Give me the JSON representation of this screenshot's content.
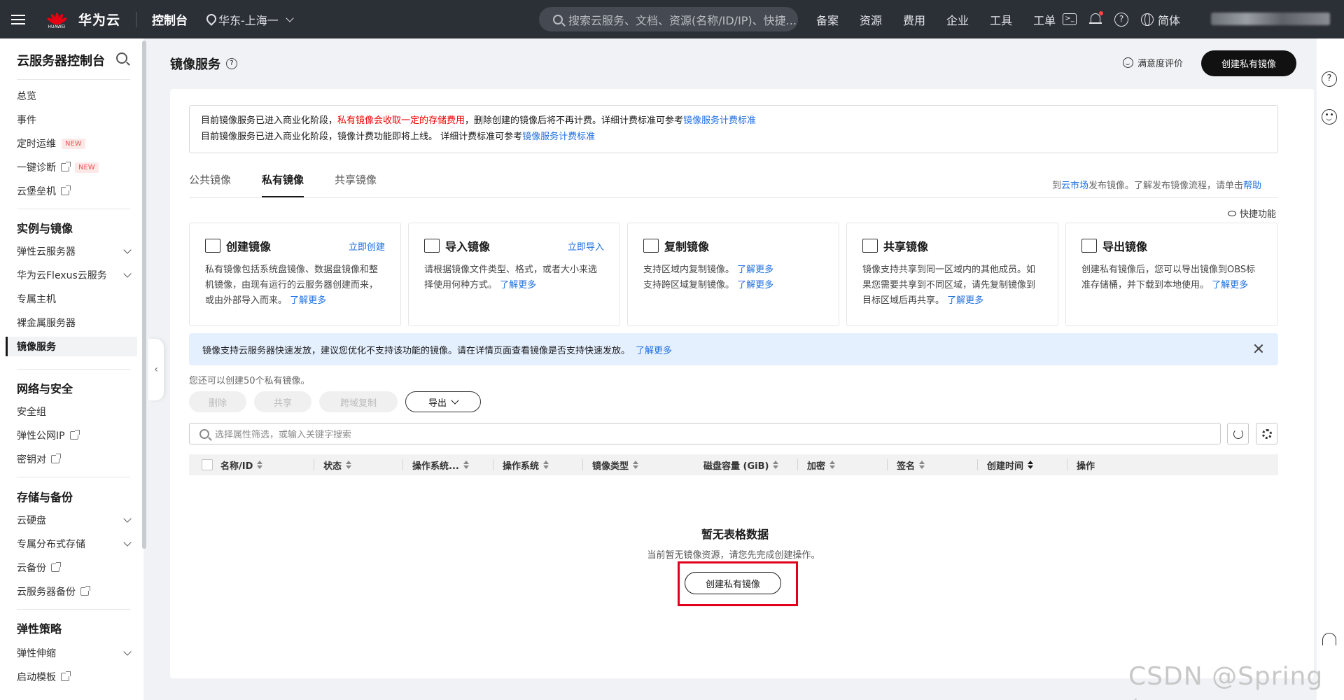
{
  "topbar": {
    "brand_small": "HUAWEI",
    "brand_name": "华为云",
    "console_label": "控制台",
    "region": "华东-上海一",
    "search_placeholder": "搜索云服务、文档、资源(名称/ID/IP)、快捷...",
    "nav": [
      "备案",
      "资源",
      "费用",
      "企业",
      "工具",
      "工单"
    ],
    "help_glyph": "?",
    "terminal_glyph": ">_",
    "language": "简体"
  },
  "sidebar": {
    "title": "云服务器控制台",
    "items_top": [
      {
        "label": "总览"
      },
      {
        "label": "事件"
      },
      {
        "label": "定时运维",
        "badge": "NEW"
      },
      {
        "label": "一键诊断",
        "badge": "NEW",
        "external": true
      },
      {
        "label": "云堡垒机",
        "external": true
      }
    ],
    "groups": [
      {
        "title": "实例与镜像",
        "items": [
          {
            "label": "弹性云服务器",
            "expandable": true
          },
          {
            "label": "华为云Flexus云服务",
            "expandable": true
          },
          {
            "label": "专属主机"
          },
          {
            "label": "裸金属服务器"
          },
          {
            "label": "镜像服务",
            "active": true
          }
        ]
      },
      {
        "title": "网络与安全",
        "items": [
          {
            "label": "安全组"
          },
          {
            "label": "弹性公网IP",
            "external": true
          },
          {
            "label": "密钥对",
            "external": true
          }
        ]
      },
      {
        "title": "存储与备份",
        "items": [
          {
            "label": "云硬盘",
            "expandable": true
          },
          {
            "label": "专属分布式存储",
            "expandable": true
          },
          {
            "label": "云备份",
            "external": true
          },
          {
            "label": "云服务器备份",
            "external": true
          }
        ]
      },
      {
        "title": "弹性策略",
        "items": [
          {
            "label": "弹性伸缩",
            "expandable": true
          },
          {
            "label": "启动模板",
            "external": true
          }
        ]
      }
    ],
    "collapse_glyph": "‹"
  },
  "page": {
    "title": "镜像服务",
    "help_glyph": "?",
    "satisfaction": "满意度评价",
    "create_button": "创建私有镜像"
  },
  "notice": {
    "line1_a": "目前镜像服务已进入商业化阶段，",
    "line1_red": "私有镜像会收取一定的存储费用",
    "line1_b": "，删除创建的镜像后将不再计费。详细计费标准可参考",
    "line1_link": "镜像服务计费标准",
    "line2_a": "目前镜像服务已进入商业化阶段，镜像计费功能即将上线。 详细计费标准可参考",
    "line2_link": "镜像服务计费标准"
  },
  "tabs": [
    {
      "label": "公共镜像"
    },
    {
      "label": "私有镜像",
      "active": true
    },
    {
      "label": "共享镜像"
    }
  ],
  "market": {
    "a": "到",
    "link1": "云市场",
    "b": "发布镜像。了解发布镜像流程，请单击",
    "link2": "帮助"
  },
  "quick_label": "快捷功能",
  "features": [
    {
      "title": "创建镜像",
      "action": "立即创建",
      "desc": "私有镜像包括系统盘镜像、数据盘镜像和整机镜像，由现有运行的云服务器创建而来，或由外部导入而来。",
      "more": "了解更多"
    },
    {
      "title": "导入镜像",
      "action": "立即导入",
      "desc": "请根据镜像文件类型、格式，或者大小来选择使用何种方式。",
      "more": "了解更多"
    },
    {
      "title": "复制镜像",
      "action": "",
      "desc": "支持区域内复制镜像。",
      "more": "了解更多",
      "desc2": "支持跨区域复制镜像。",
      "more2": "了解更多"
    },
    {
      "title": "共享镜像",
      "action": "",
      "desc": "镜像支持共享到同一区域内的其他成员。如果您需要共享到不同区域，请先复制镜像到目标区域后再共享。",
      "more": "了解更多"
    },
    {
      "title": "导出镜像",
      "action": "",
      "desc": "创建私有镜像后，您可以导出镜像到OBS标准存储桶，并下载到本地使用。",
      "more": "了解更多"
    }
  ],
  "banner": {
    "text": "镜像支持云服务器快速发放，建议您优化不支持该功能的镜像。请在详情页面查看镜像是否支持快速发放。",
    "link": "了解更多"
  },
  "quota": "您还可以创建50个私有镜像。",
  "actions": {
    "delete": "删除",
    "share": "共享",
    "cross_copy": "跨域复制",
    "export": "导出"
  },
  "filter_placeholder": "选择属性筛选，或输入关键字搜索",
  "table": {
    "columns": [
      "名称/ID",
      "状态",
      "操作系统...",
      "操作系统",
      "镜像类型",
      "磁盘容量 (GiB)",
      "加密",
      "签名",
      "创建时间",
      "操作"
    ],
    "empty_title": "暂无表格数据",
    "empty_desc": "当前暂无镜像资源，请您先完成创建操作。",
    "empty_button": "创建私有镜像"
  },
  "right_rail": {
    "help_glyph": "?"
  },
  "watermark": "CSDN @Spring 胡",
  "colors": {
    "accent": "#1d6fe2",
    "warning_red": "#e00000",
    "highlight_box": "#e0001b",
    "topbar": "#2b2f36"
  }
}
